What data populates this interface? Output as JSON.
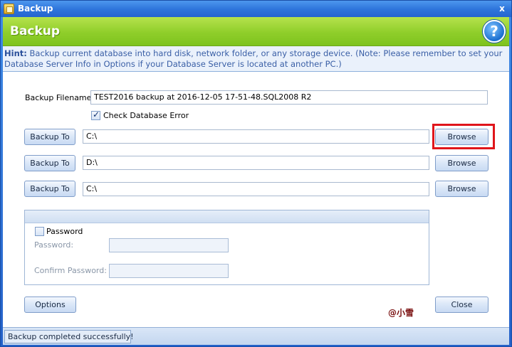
{
  "window": {
    "title": "Backup",
    "close_symbol": "x"
  },
  "banner": {
    "title": "Backup",
    "help_symbol": "?"
  },
  "hint": {
    "label": "Hint:",
    "text": " Backup current database into hard disk, network folder, or any storage device. (Note: Please remember to set your Database Server Info in Options if your Database Server is located at another PC.)"
  },
  "form": {
    "filename_label": "Backup Filename:",
    "filename_value": "TEST2016 backup at 2016-12-05 17-51-48.SQL2008 R2",
    "check_db_error_label": "Check Database Error",
    "check_db_error_checked": true,
    "backup_rows": [
      {
        "button": "Backup To",
        "path": "C:\\",
        "browse": "Browse"
      },
      {
        "button": "Backup To",
        "path": "D:\\",
        "browse": "Browse"
      },
      {
        "button": "Backup To",
        "path": "C:\\",
        "browse": "Browse"
      }
    ]
  },
  "password_group": {
    "checkbox_label": "Password",
    "checked": false,
    "password_label": "Password:",
    "confirm_label": "Confirm Password:",
    "password_value": "",
    "confirm_value": ""
  },
  "buttons": {
    "options": "Options",
    "close": "Close"
  },
  "watermark": "@小雪",
  "status": {
    "text": "Backup completed successfully!"
  },
  "colors": {
    "banner_green": "#8fce2a",
    "title_blue": "#2f76dc",
    "highlight_red": "#e0151b"
  }
}
